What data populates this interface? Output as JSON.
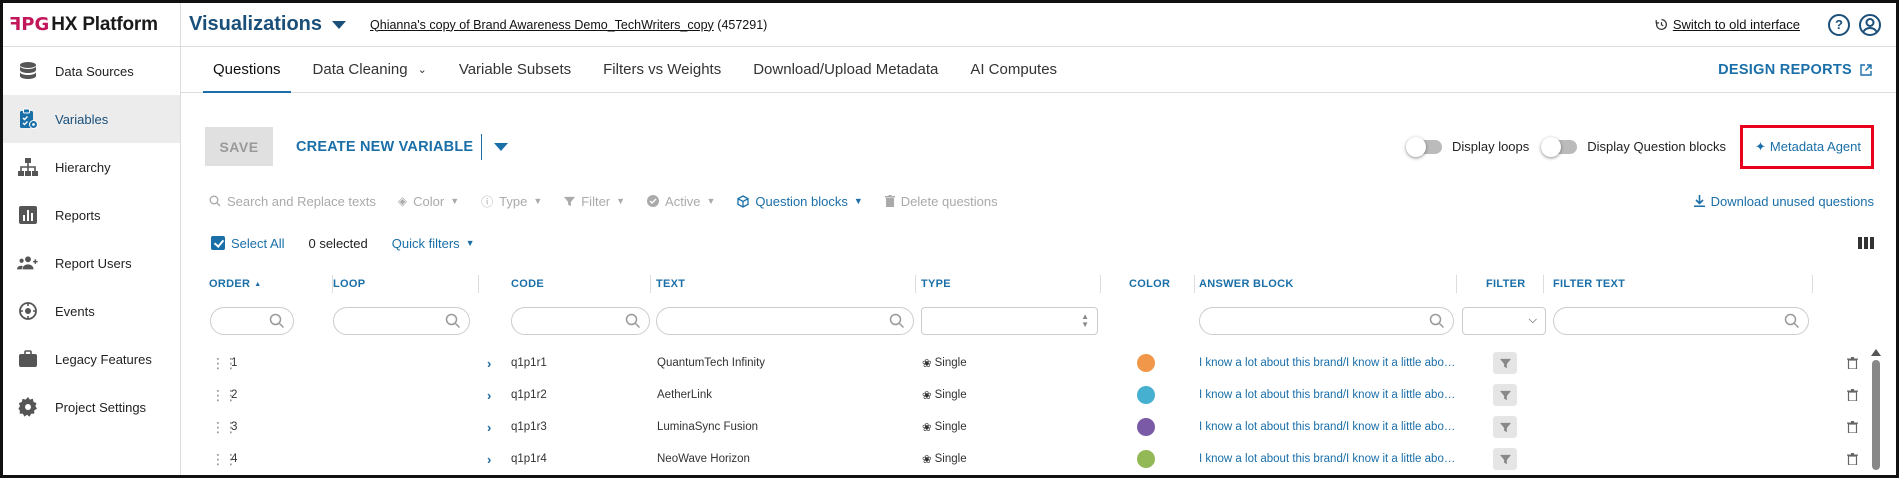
{
  "header": {
    "brand_logo": "ꟻPG",
    "brand_name": "HX Platform",
    "section_title": "Visualizations",
    "project_name": "Qhianna's copy of Brand Awareness Demo_TechWriters_copy",
    "project_id": "(457291)",
    "switch_label": "Switch to old interface",
    "help_glyph": "?"
  },
  "sidebar": {
    "items": [
      {
        "label": "Data Sources",
        "icon": "database-icon"
      },
      {
        "label": "Variables",
        "icon": "clipboard-gear-icon"
      },
      {
        "label": "Hierarchy",
        "icon": "hierarchy-icon"
      },
      {
        "label": "Reports",
        "icon": "bar-chart-icon"
      },
      {
        "label": "Report Users",
        "icon": "users-icon"
      },
      {
        "label": "Events",
        "icon": "events-icon"
      },
      {
        "label": "Legacy Features",
        "icon": "briefcase-icon"
      },
      {
        "label": "Project Settings",
        "icon": "gear-icon"
      }
    ],
    "active_index": 1
  },
  "tabs": {
    "items": [
      "Questions",
      "Data Cleaning",
      "Variable Subsets",
      "Filters vs Weights",
      "Download/Upload Metadata",
      "AI Computes"
    ],
    "active_index": 0,
    "design_reports": "DESIGN REPORTS"
  },
  "actions": {
    "save": "SAVE",
    "create_new_variable": "CREATE NEW VARIABLE",
    "display_loops": "Display loops",
    "display_question_blocks": "Display Question blocks",
    "metadata_agent": "Metadata Agent"
  },
  "filters": {
    "search_replace": "Search and Replace texts",
    "color": "Color",
    "type": "Type",
    "filter": "Filter",
    "active": "Active",
    "question_blocks": "Question blocks",
    "delete_questions": "Delete questions",
    "download_unused": "Download unused questions"
  },
  "selection": {
    "select_all": "Select All",
    "selected_count": "0 selected",
    "quick_filters": "Quick filters"
  },
  "table": {
    "headers": {
      "order": "ORDER",
      "loop": "LOOP",
      "code": "CODE",
      "text": "TEXT",
      "type": "TYPE",
      "color": "COLOR",
      "answer_block": "ANSWER BLOCK",
      "filter": "FILTER",
      "filter_text": "FILTER TEXT"
    },
    "rows": [
      {
        "order": "1",
        "code": "q1p1r1",
        "text": "QuantumTech Infinity",
        "type": "Single",
        "color": "#f0974a",
        "answer_block": "I know a lot about this brand/I know it a little about this brand"
      },
      {
        "order": "2",
        "code": "q1p1r2",
        "text": "AetherLink",
        "type": "Single",
        "color": "#45b0cf",
        "answer_block": "I know a lot about this brand/I know it a little about this brand"
      },
      {
        "order": "3",
        "code": "q1p1r3",
        "text": "LuminaSync Fusion",
        "type": "Single",
        "color": "#7a5aa6",
        "answer_block": "I know a lot about this brand/I know it a little about this brand"
      },
      {
        "order": "4",
        "code": "q1p1r4",
        "text": "NeoWave Horizon",
        "type": "Single",
        "color": "#93b956",
        "answer_block": "I know a lot about this brand/I know it a little about this brand"
      }
    ]
  },
  "colors": {
    "accent": "#1a6fa8",
    "brand_dark": "#1a4f7a",
    "highlight_box": "#e8001c"
  }
}
